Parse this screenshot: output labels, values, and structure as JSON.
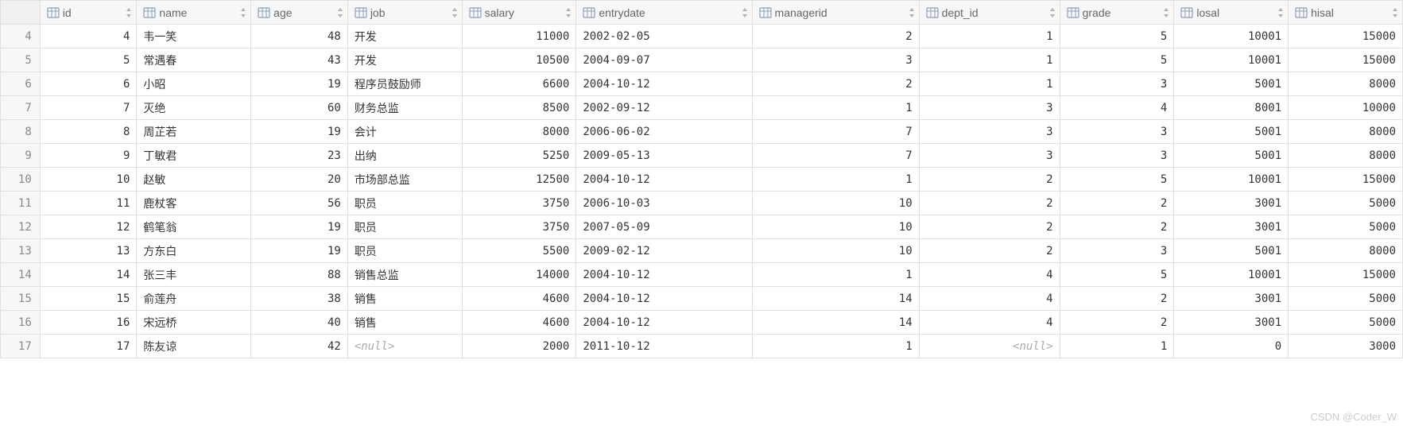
{
  "columns": [
    {
      "name": "id",
      "align": "num"
    },
    {
      "name": "name",
      "align": "txt"
    },
    {
      "name": "age",
      "align": "num"
    },
    {
      "name": "job",
      "align": "txt"
    },
    {
      "name": "salary",
      "align": "num"
    },
    {
      "name": "entrydate",
      "align": "txt"
    },
    {
      "name": "managerid",
      "align": "num"
    },
    {
      "name": "dept_id",
      "align": "num"
    },
    {
      "name": "grade",
      "align": "num"
    },
    {
      "name": "losal",
      "align": "num"
    },
    {
      "name": "hisal",
      "align": "num"
    }
  ],
  "rows": [
    {
      "n": "4",
      "cells": [
        "4",
        "韦一笑",
        "48",
        "开发",
        "11000",
        "2002-02-05",
        "2",
        "1",
        "5",
        "10001",
        "15000"
      ]
    },
    {
      "n": "5",
      "cells": [
        "5",
        "常遇春",
        "43",
        "开发",
        "10500",
        "2004-09-07",
        "3",
        "1",
        "5",
        "10001",
        "15000"
      ]
    },
    {
      "n": "6",
      "cells": [
        "6",
        "小昭",
        "19",
        "程序员鼓励师",
        "6600",
        "2004-10-12",
        "2",
        "1",
        "3",
        "5001",
        "8000"
      ]
    },
    {
      "n": "7",
      "cells": [
        "7",
        "灭绝",
        "60",
        "财务总监",
        "8500",
        "2002-09-12",
        "1",
        "3",
        "4",
        "8001",
        "10000"
      ]
    },
    {
      "n": "8",
      "cells": [
        "8",
        "周芷若",
        "19",
        "会计",
        "8000",
        "2006-06-02",
        "7",
        "3",
        "3",
        "5001",
        "8000"
      ]
    },
    {
      "n": "9",
      "cells": [
        "9",
        "丁敏君",
        "23",
        "出纳",
        "5250",
        "2009-05-13",
        "7",
        "3",
        "3",
        "5001",
        "8000"
      ]
    },
    {
      "n": "10",
      "cells": [
        "10",
        "赵敏",
        "20",
        "市场部总监",
        "12500",
        "2004-10-12",
        "1",
        "2",
        "5",
        "10001",
        "15000"
      ]
    },
    {
      "n": "11",
      "cells": [
        "11",
        "鹿杖客",
        "56",
        "职员",
        "3750",
        "2006-10-03",
        "10",
        "2",
        "2",
        "3001",
        "5000"
      ]
    },
    {
      "n": "12",
      "cells": [
        "12",
        "鹤笔翁",
        "19",
        "职员",
        "3750",
        "2007-05-09",
        "10",
        "2",
        "2",
        "3001",
        "5000"
      ]
    },
    {
      "n": "13",
      "cells": [
        "13",
        "方东白",
        "19",
        "职员",
        "5500",
        "2009-02-12",
        "10",
        "2",
        "3",
        "5001",
        "8000"
      ]
    },
    {
      "n": "14",
      "cells": [
        "14",
        "张三丰",
        "88",
        "销售总监",
        "14000",
        "2004-10-12",
        "1",
        "4",
        "5",
        "10001",
        "15000"
      ]
    },
    {
      "n": "15",
      "cells": [
        "15",
        "俞莲舟",
        "38",
        "销售",
        "4600",
        "2004-10-12",
        "14",
        "4",
        "2",
        "3001",
        "5000"
      ]
    },
    {
      "n": "16",
      "cells": [
        "16",
        "宋远桥",
        "40",
        "销售",
        "4600",
        "2004-10-12",
        "14",
        "4",
        "2",
        "3001",
        "5000"
      ]
    },
    {
      "n": "17",
      "cells": [
        "17",
        "陈友谅",
        "42",
        null,
        "2000",
        "2011-10-12",
        "1",
        null,
        "1",
        "0",
        "3000"
      ]
    }
  ],
  "null_text": "<null>",
  "watermark": "CSDN @Coder_W"
}
